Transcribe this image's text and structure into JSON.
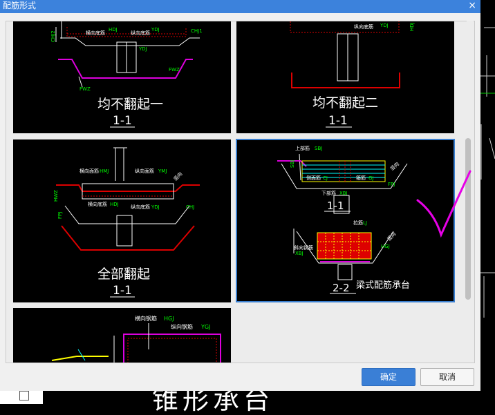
{
  "dialog": {
    "title": "配筋形式",
    "close_glyph": "×",
    "ok_label": "确定",
    "cancel_label": "取消"
  },
  "tiles": [
    {
      "caption": "均不翻起一",
      "section": "1-1",
      "labels": [
        "横向底筋",
        "纵向底筋",
        "横向底筋",
        "CHJ2",
        "CHJ1",
        "FPJ",
        "FWZ",
        "YDJ",
        "HDJ"
      ]
    },
    {
      "caption": "均不翻起二",
      "section": "1-1",
      "labels": [
        "纵向底筋",
        "YDJ",
        "HDJ"
      ]
    },
    {
      "caption": "全部翻起",
      "section": "1-1",
      "labels": [
        "横向面筋",
        "纵向面筋",
        "横向底筋",
        "纵向底筋",
        "CHJ",
        "FPJ",
        "YDJ",
        "HMJ",
        "YMJ",
        "HDJ"
      ]
    },
    {
      "caption": "",
      "section": "1-1",
      "section2": "2-2",
      "name": "梁式配筋承台",
      "labels": [
        "上部筋",
        "SBJ",
        "侧面筋",
        "CJ",
        "箍筋",
        "GJ",
        "下部筋",
        "XBJ",
        "FPJ",
        "拉筋",
        "LJ",
        "斜向钢筋",
        "XBJ",
        "HGJ"
      ]
    },
    {
      "caption": "",
      "section": "",
      "labels": [
        "横向钢筋",
        "HGJ",
        "纵向钢筋",
        "YGJ"
      ]
    }
  ],
  "background": {
    "big_text": "锥形承台"
  },
  "colors": {
    "accent": "#3a7fd6",
    "title_bar": "#3c82dc",
    "annotation": "#ff00ff"
  }
}
